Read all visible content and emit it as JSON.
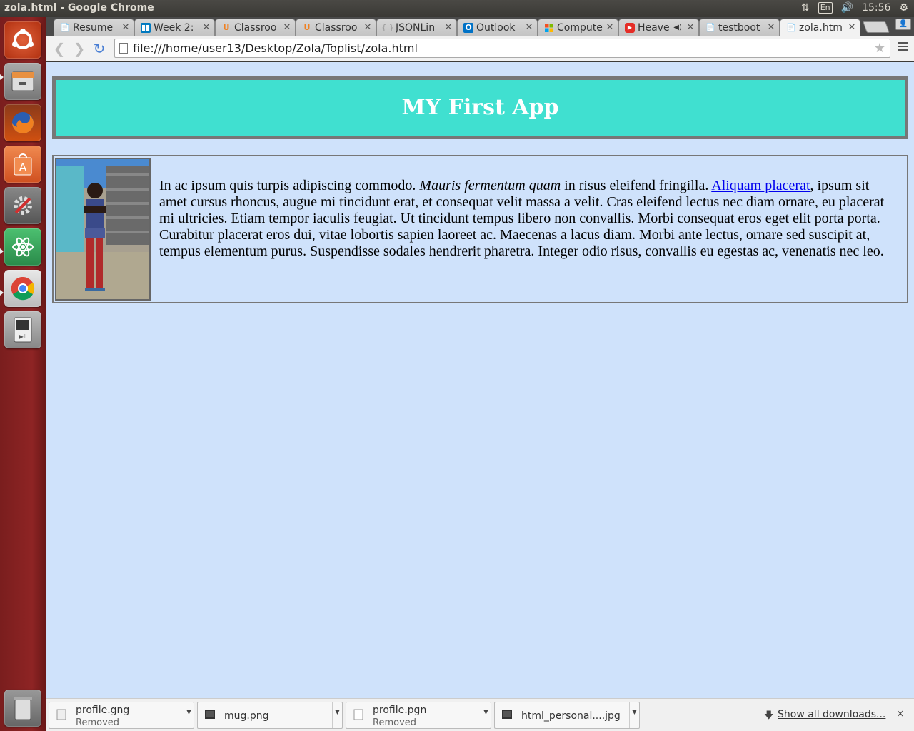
{
  "system_panel": {
    "window_title": "zola.html - Google Chrome",
    "keyboard_layout": "En",
    "clock": "15:56"
  },
  "launcher": {
    "items": [
      {
        "name": "ubuntu-dash-icon",
        "color": "#dd4814"
      },
      {
        "name": "files-icon",
        "color": "#8a8a8a"
      },
      {
        "name": "firefox-icon",
        "color": "#e66000"
      },
      {
        "name": "software-center-icon",
        "color": "#f07040"
      },
      {
        "name": "system-settings-icon",
        "color": "#aaaaaa"
      },
      {
        "name": "atom-editor-icon",
        "color": "#3aaa5a"
      },
      {
        "name": "chrome-icon",
        "color": "#dddddd"
      },
      {
        "name": "media-player-icon",
        "color": "#999999"
      },
      {
        "name": "trash-icon",
        "color": "#aaaaaa"
      }
    ]
  },
  "tabs": [
    {
      "label": "Resume",
      "icon": "doc"
    },
    {
      "label": "Week 2: ",
      "icon": "trello"
    },
    {
      "label": "Classroo",
      "icon": "udacity"
    },
    {
      "label": "Classroo",
      "icon": "udacity"
    },
    {
      "label": "JSONLin",
      "icon": "json"
    },
    {
      "label": "Outlook",
      "icon": "outlook"
    },
    {
      "label": "Compute",
      "icon": "microsoft"
    },
    {
      "label": "Heave",
      "icon": "youtube"
    },
    {
      "label": "testboot",
      "icon": "doc"
    },
    {
      "label": "zola.htm",
      "icon": "doc"
    }
  ],
  "toolbar": {
    "url": "file:///home/user13/Desktop/Zola/Toplist/zola.html"
  },
  "page": {
    "heading": "MY First App",
    "paragraph_start": "In ac ipsum quis turpis adipiscing commodo. ",
    "paragraph_italic": "Mauris fermentum quam",
    "paragraph_middle": " in risus eleifend fringilla. ",
    "paragraph_link": "Aliquam placerat",
    "paragraph_end": ", ipsum sit amet cursus rhoncus, augue mi tincidunt erat, et consequat velit massa a velit. Cras eleifend lectus nec diam ornare, eu placerat mi ultricies. Etiam tempor iaculis feugiat. Ut tincidunt tempus libero non convallis. Morbi consequat eros eget elit porta porta. Curabitur placerat eros dui, vitae lobortis sapien laoreet ac. Maecenas a lacus diam. Morbi ante lectus, ornare sed suscipit at, tempus elementum purus. Suspendisse sodales hendrerit pharetra. Integer odio risus, convallis eu egestas ac, venenatis nec leo."
  },
  "downloads": {
    "items": [
      {
        "name": "profile.gng",
        "status": "Removed"
      },
      {
        "name": "mug.png",
        "status": ""
      },
      {
        "name": "profile.pgn",
        "status": "Removed"
      },
      {
        "name": "html_personal....jpg",
        "status": ""
      }
    ],
    "show_all": "Show all downloads...",
    "close": "×"
  },
  "colors": {
    "page_background": "#cfe2fb",
    "header_background": "#40e0d0",
    "launcher": "#8e2424"
  }
}
